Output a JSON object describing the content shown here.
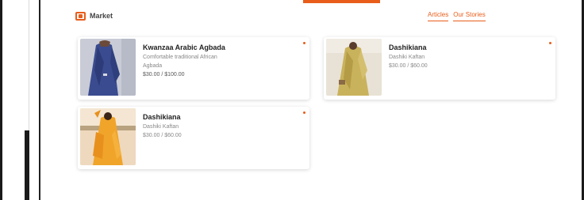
{
  "brand": {
    "label": "Market"
  },
  "links": {
    "primary": "Articles",
    "secondary": "Our Stories"
  },
  "colors": {
    "accent": "#e85d1a"
  },
  "cards": [
    {
      "title": "Kwanzaa Arabic Agbada",
      "lines": [
        "Comfortable traditional African",
        "Agbada",
        "$30.00 / $100.00"
      ],
      "image": "man-in-blue-agbada"
    },
    {
      "title": "Dashikiana",
      "lines": [
        "Dashiki Kaftan",
        "$30.00 / $60.00"
      ],
      "image": "person-in-yellow-kaftan"
    },
    {
      "title": "Dashikiana",
      "lines": [
        "Dashiki Kaftan",
        "$30.00 / $60.00"
      ],
      "image": "woman-in-orange-dress"
    }
  ]
}
